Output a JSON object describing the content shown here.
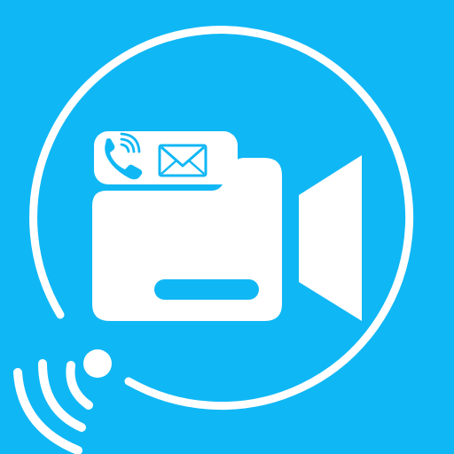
{
  "app_icon": {
    "name": "video-call-app-icon",
    "colors": {
      "background": "#10b7f5",
      "foreground": "#ffffff"
    },
    "icons": {
      "camera": "video-camera-icon",
      "phone": "phone-ringing-icon",
      "mail": "envelope-icon",
      "signal": "wireless-signal-icon"
    }
  }
}
